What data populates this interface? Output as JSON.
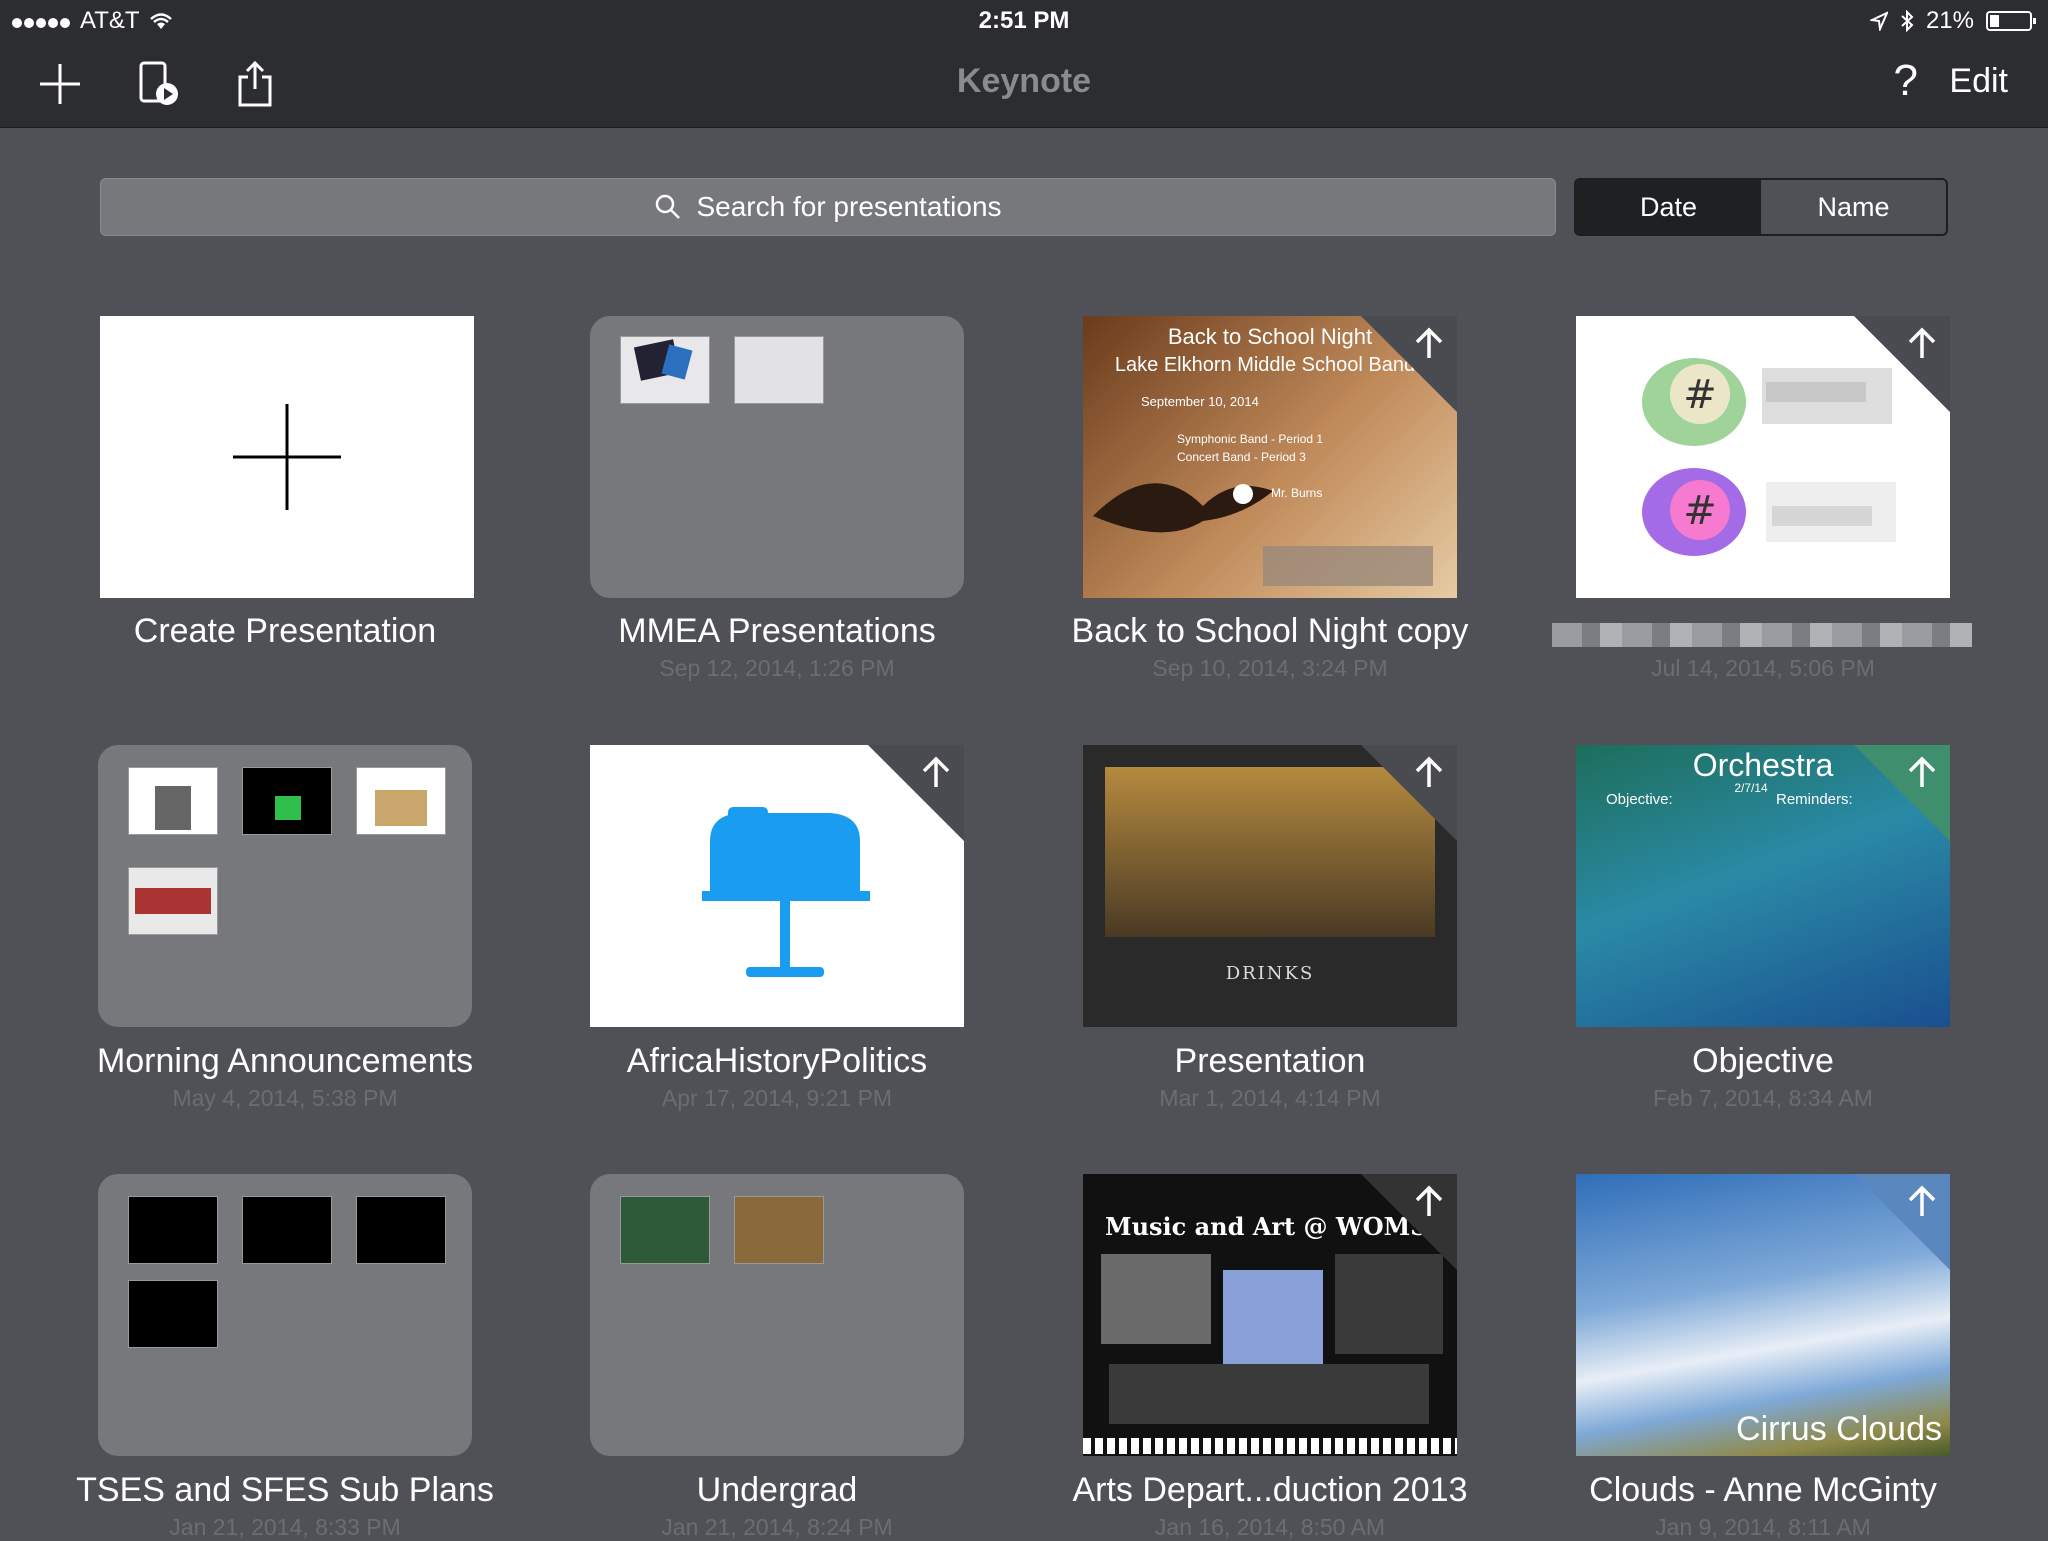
{
  "status": {
    "carrier": "AT&T",
    "time": "2:51 PM",
    "battery": "21%"
  },
  "toolbar": {
    "title": "Keynote",
    "edit_label": "Edit",
    "help_label": "?"
  },
  "search": {
    "placeholder": "Search for presentations"
  },
  "sort": {
    "options": [
      "Date",
      "Name"
    ],
    "selected": "Date"
  },
  "items": [
    {
      "name": "Create Presentation",
      "date": ""
    },
    {
      "name": "MMEA Presentations",
      "date": "Sep 12, 2014, 1:26 PM"
    },
    {
      "name": "Back to School Night copy",
      "date": "Sep 10, 2014, 3:24 PM"
    },
    {
      "name": "",
      "date": "Jul 14, 2014, 5:06 PM"
    },
    {
      "name": "Morning Announcements",
      "date": "May 4, 2014, 5:38 PM"
    },
    {
      "name": "AfricaHistoryPolitics",
      "date": "Apr 17, 2014, 9:21 PM"
    },
    {
      "name": "Presentation",
      "date": "Mar 1, 2014, 4:14 PM"
    },
    {
      "name": "Objective",
      "date": "Feb 7, 2014, 8:34 AM"
    },
    {
      "name": "TSES and SFES Sub Plans",
      "date": "Jan 21, 2014, 8:33 PM"
    },
    {
      "name": "Undergrad",
      "date": "Jan 21, 2014, 8:24 PM"
    },
    {
      "name": "Arts Depart...duction 2013",
      "date": "Jan 16, 2014, 8:50 AM"
    },
    {
      "name": "Clouds - Anne McGinty",
      "date": "Jan 9, 2014, 8:11 AM"
    }
  ],
  "slides": {
    "bts_title1": "Back to School Night",
    "bts_title2": "Lake Elkhorn Middle School Bands",
    "bts_date": "September 10, 2014",
    "bts_line1": "Symphonic Band - Period 1",
    "bts_line2": "Concert Band - Period 3",
    "bts_teacher": "Mr. Burns",
    "drinks": "DRINKS",
    "orchestra": "Orchestra",
    "orchestra_date": "2/7/14",
    "objective": "Objective:",
    "reminders": "Reminders:",
    "music_art": "Music and Art @ WOMS",
    "cirrus": "Cirrus Clouds"
  }
}
